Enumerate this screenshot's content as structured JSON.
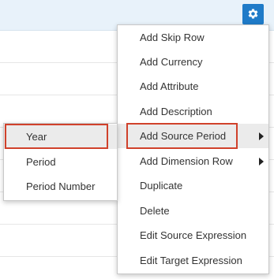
{
  "toolbar": {
    "settings_icon": "gear-icon",
    "accent_color": "#1f7bc8"
  },
  "context_menu": {
    "items": [
      {
        "label": "Add Skip Row",
        "submenu": false
      },
      {
        "label": "Add Currency",
        "submenu": false
      },
      {
        "label": "Add Attribute",
        "submenu": false
      },
      {
        "label": "Add Description",
        "submenu": false
      },
      {
        "label": "Add Source Period",
        "submenu": true,
        "active": true
      },
      {
        "label": "Add Dimension Row",
        "submenu": true
      },
      {
        "label": "Duplicate",
        "submenu": false
      },
      {
        "label": "Delete",
        "submenu": false
      },
      {
        "label": "Edit Source Expression",
        "submenu": false
      },
      {
        "label": "Edit Target Expression",
        "submenu": false
      }
    ]
  },
  "submenu": {
    "items": [
      {
        "label": "Year",
        "active": true
      },
      {
        "label": "Period"
      },
      {
        "label": "Period Number"
      }
    ]
  },
  "highlight_color": "#d0412b"
}
